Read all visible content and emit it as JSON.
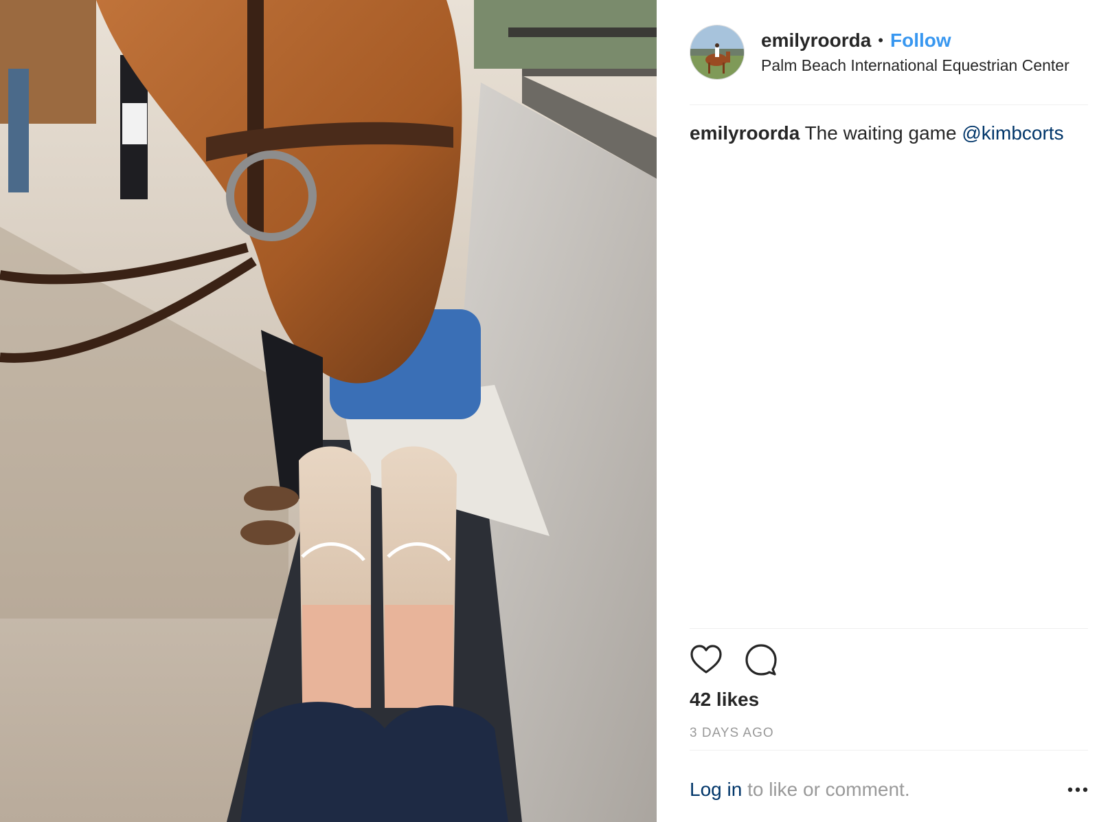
{
  "post": {
    "username": "emilyroorda",
    "separator": "•",
    "follow_label": "Follow",
    "location": "Palm Beach International Equestrian Center",
    "caption": {
      "username": "emilyroorda",
      "text": "The waiting game",
      "mention": "@kimbcorts"
    },
    "likes": "42 likes",
    "timestamp": "3 DAYS AGO",
    "login_link": "Log in",
    "login_suffix": "to like or comment.",
    "more_icon": "ellipsis-icon",
    "like_icon": "heart-icon",
    "comment_icon": "comment-icon"
  },
  "colors": {
    "follow": "#3897f0",
    "mention": "#003569",
    "muted": "#999999",
    "text": "#262626"
  }
}
